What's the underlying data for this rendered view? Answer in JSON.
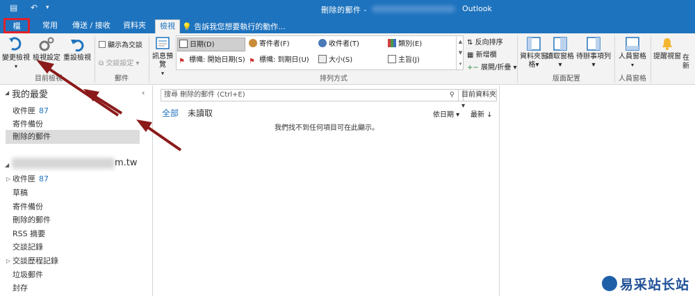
{
  "titlebar": {
    "title": "刪除的郵件 -",
    "app": "Outlook"
  },
  "tabs": {
    "file": "檔案",
    "home": "常用",
    "send_receive": "傳送 / 接收",
    "folder": "資料夾",
    "view": "檢視",
    "tell_me": "告訴我您想要執行的動作..."
  },
  "ribbon": {
    "current_view": {
      "change_view": "變更檢視",
      "view_settings": "檢視設定",
      "reset_view": "重設檢視",
      "label": "目前檢視"
    },
    "messages": {
      "show_as_conversations": "顯示為交談",
      "conversation_settings": "交談設定",
      "label": "郵件"
    },
    "message_preview": "訊息預覽",
    "arrangement": {
      "items": [
        "日期(D)",
        "寄件者(F)",
        "收件者(T)",
        "類別(E)",
        "標幟: 開始日期(S)",
        "標幟: 到期日(U)",
        "大小(S)",
        "主旨(J)"
      ],
      "reverse_sort": "反向排序",
      "add_columns": "新增欄",
      "expand_collapse": "展開/折疊",
      "label": "排列方式"
    },
    "layout": {
      "folder_pane": "資料夾窗格",
      "reading_pane": "讀取窗格",
      "todo_bar": "待辦事項列",
      "label": "版面配置"
    },
    "people_pane": {
      "people_pane": "人員窗格",
      "label": "人員窗格"
    },
    "reminders_window": "提醒視窗",
    "open_in": "在新"
  },
  "nav": {
    "favorites": "我的最愛",
    "fav_items": [
      {
        "label": "收件匣",
        "count": "87"
      },
      {
        "label": "寄件備份"
      },
      {
        "label": "刪除的郵件"
      }
    ],
    "account_suffix": "m.tw",
    "folders": [
      {
        "label": "收件匣",
        "count": "87"
      },
      {
        "label": "草稿"
      },
      {
        "label": "寄件備份"
      },
      {
        "label": "刪除的郵件"
      },
      {
        "label": "RSS 摘要"
      },
      {
        "label": "交談記錄"
      },
      {
        "label": "交談歷程記錄"
      },
      {
        "label": "垃圾郵件"
      },
      {
        "label": "封存"
      }
    ]
  },
  "mail_list": {
    "search_placeholder": "搜尋 刪除的郵件 (Ctrl+E)",
    "scope": "目前資料夾",
    "filter_all": "全部",
    "filter_unread": "未讀取",
    "sort_by": "依日期",
    "sort_order": "最新",
    "empty_message": "我們找不到任何項目可在此顯示。"
  },
  "watermark": {
    "text": "易采站长站"
  },
  "colors": {
    "brand": "#1e73be",
    "highlight": "#e0202a",
    "arrow": "#8b1a1a"
  }
}
